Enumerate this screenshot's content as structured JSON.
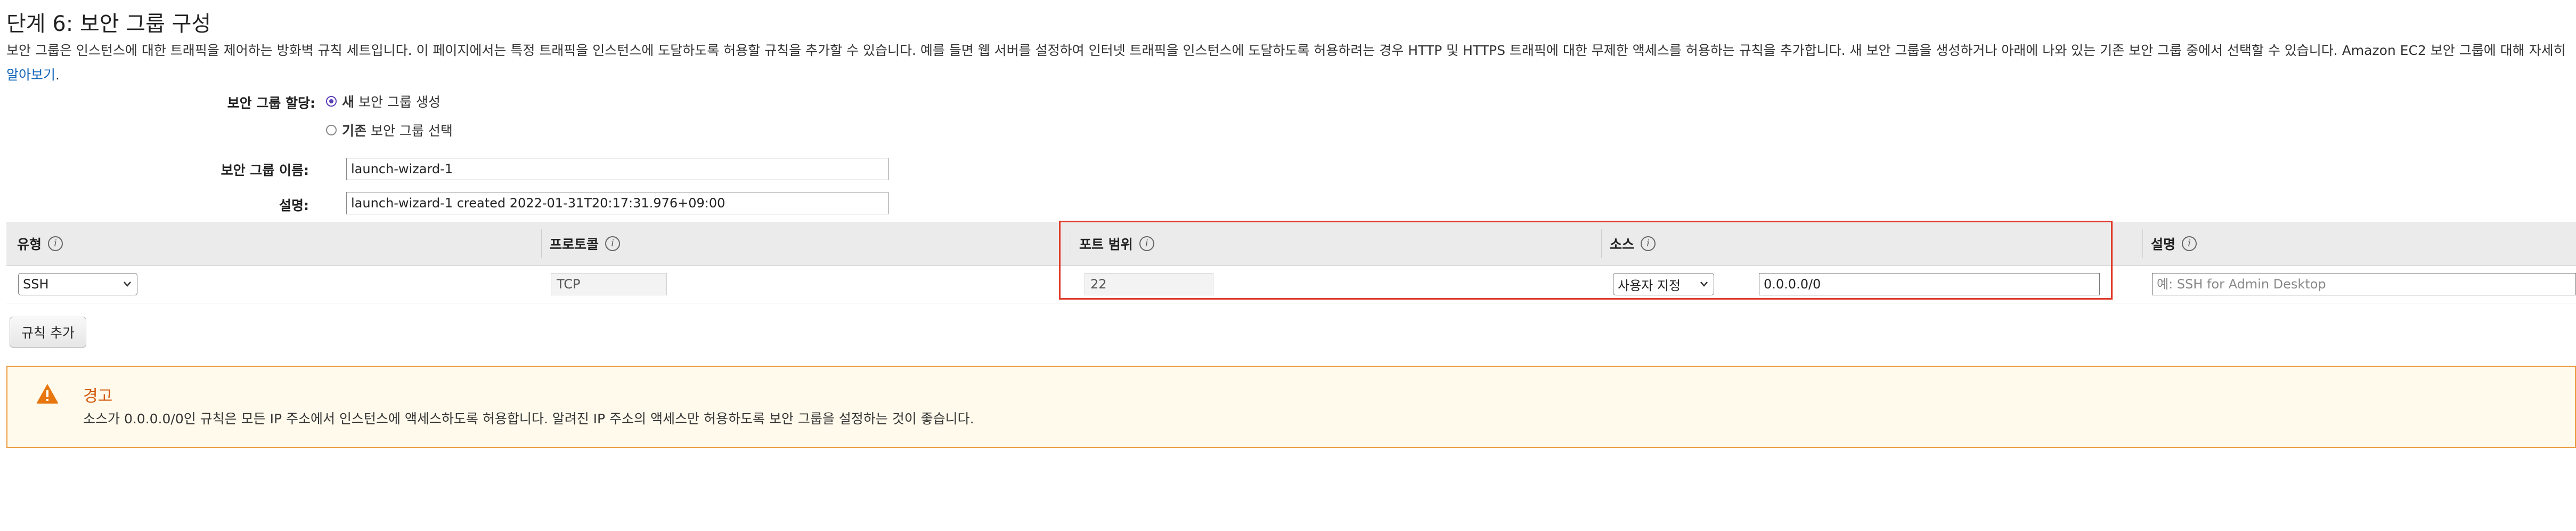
{
  "page": {
    "title": "단계 6: 보안 그룹 구성",
    "intro": "보안 그룹은 인스턴스에 대한 트래픽을 제어하는 방화벽 규칙 세트입니다. 이 페이지에서는 특정 트래픽을 인스턴스에 도달하도록 허용할 규칙을 추가할 수 있습니다. 예를 들면 웹 서버를 설정하여 인터넷 트래픽을 인스턴스에 도달하도록 허용하려는 경우 HTTP 및 HTTPS 트래픽에 대한 무제한 액세스를 허용하는 규칙을 추가합니다. 새 보안 그룹을 생성하거나 아래에 나와 있는 기존 보안 그룹 중에서 선택할 수 있습니다. Amazon EC2 보안 그룹에 대해 자세히",
    "intro_link": "알아보기",
    "intro_tail": "."
  },
  "form": {
    "assign_label": "보안 그룹 할당:",
    "radio_new_bold": "새",
    "radio_new_rest": "보안 그룹 생성",
    "radio_existing_bold": "기존",
    "radio_existing_rest": "보안 그룹 선택",
    "radio_new_selected": true,
    "name_label": "보안 그룹 이름:",
    "name_value": "launch-wizard-1",
    "desc_label": "설명:",
    "desc_value": "launch-wizard-1 created 2022-01-31T20:17:31.976+09:00"
  },
  "rules_table": {
    "headers": {
      "type": "유형",
      "protocol": "프로토콜",
      "port_range": "포트 범위",
      "source": "소스",
      "description": "설명"
    },
    "info_glyph": "i",
    "rows": [
      {
        "type": "SSH",
        "protocol": "TCP",
        "port_range": "22",
        "source_mode": "사용자 지정",
        "source_cidr": "0.0.0.0/0",
        "description_placeholder": "예: SSH for Admin Desktop"
      }
    ],
    "add_rule_label": "규칙 추가"
  },
  "warning": {
    "title": "경고",
    "text": "소스가 0.0.0.0/0인 규칙은 모든 IP 주소에서 인스턴스에 액세스하도록 허용합니다. 알려진 IP 주소의 액세스만 허용하도록 보안 그룹을 설정하는 것이 좋습니다.",
    "icon": "warning-triangle-icon"
  },
  "colors": {
    "highlight": "#e03a2a",
    "warning_border": "#ec9a3c",
    "warning_title": "#d35a0c",
    "link": "#1166bb",
    "radio_selected": "#5a3fb8"
  }
}
